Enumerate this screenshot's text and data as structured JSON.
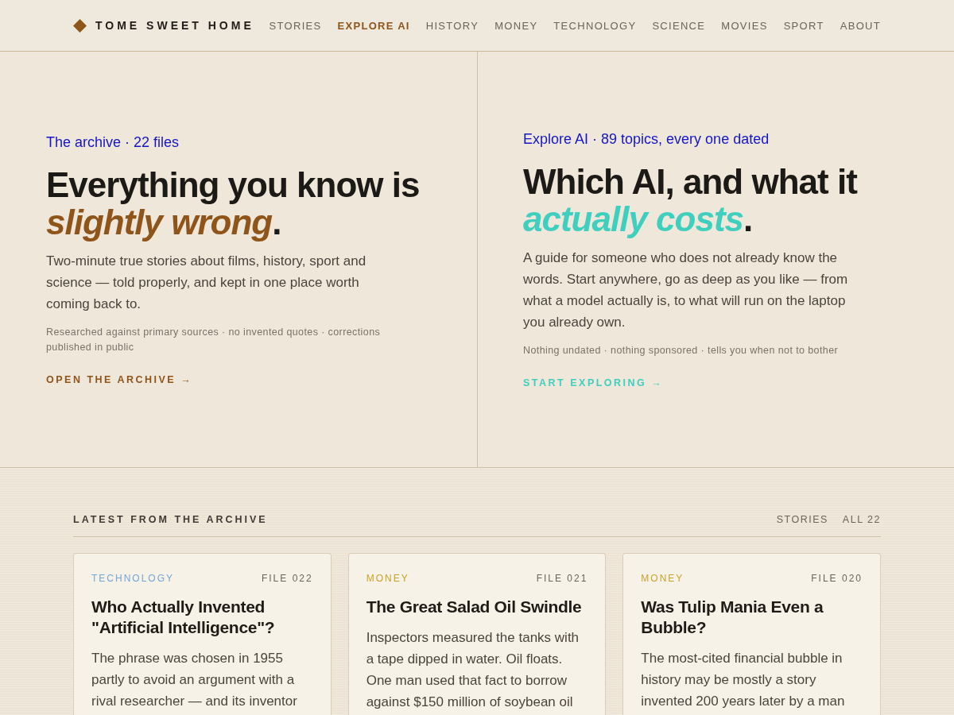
{
  "brand": {
    "name": "TOME SWEET HOME"
  },
  "nav": [
    {
      "label": "STORIES",
      "selected": false
    },
    {
      "label": "EXPLORE AI",
      "selected": true
    },
    {
      "label": "HISTORY",
      "selected": false
    },
    {
      "label": "MONEY",
      "selected": false
    },
    {
      "label": "TECHNOLOGY",
      "selected": false
    },
    {
      "label": "SCIENCE",
      "selected": false
    },
    {
      "label": "MOVIES",
      "selected": false
    },
    {
      "label": "SPORT",
      "selected": false
    },
    {
      "label": "ABOUT",
      "selected": false
    }
  ],
  "hero_panels": [
    {
      "eyebrow": "The archive · 22 files",
      "headline": "Everything you know is *slightly wrong*.",
      "body": "Two-minute true stories about films, history, sport and science — told properly, and kept in one place worth coming back to.",
      "note": "Researched against primary sources · no invented quotes · corrections published in public",
      "cta": "OPEN THE ARCHIVE →",
      "color": "#8f5419"
    },
    {
      "eyebrow": "Explore AI · 89 topics, every one dated",
      "headline": "Which AI, and what it *actually costs*.",
      "body": "A guide for someone who does not already know the words. Start anywhere, go as deep as you like — from what a model actually is, to what will run on the laptop you already own.",
      "note": "Nothing undated · nothing sponsored · tells you when not to bother",
      "cta": "START EXPLORING →",
      "color": "#3fcfbf"
    }
  ],
  "latest": {
    "title": "LATEST FROM THE ARCHIVE",
    "links": [
      "STORIES",
      "ALL 22"
    ],
    "cards": [
      {
        "category": "TECHNOLOGY",
        "color": "#72a6d6",
        "file": "FILE 022",
        "title": "Who Actually Invented \"Artificial Intelligence\"?",
        "excerpt": "The phrase was chosen in 1955 partly to avoid an argument with a rival researcher — and its inventor"
      },
      {
        "category": "MONEY",
        "color": "#c9a227",
        "file": "FILE 021",
        "title": "The Great Salad Oil Swindle",
        "excerpt": "Inspectors measured the tanks with a tape dipped in water. Oil floats. One man used that fact to borrow against $150 million of soybean oil"
      },
      {
        "category": "MONEY",
        "color": "#c9a227",
        "file": "FILE 020",
        "title": "Was Tulip Mania Even a Bubble?",
        "excerpt": "The most-cited financial bubble in history may be mostly a story invented 200 years later by a man"
      }
    ]
  }
}
